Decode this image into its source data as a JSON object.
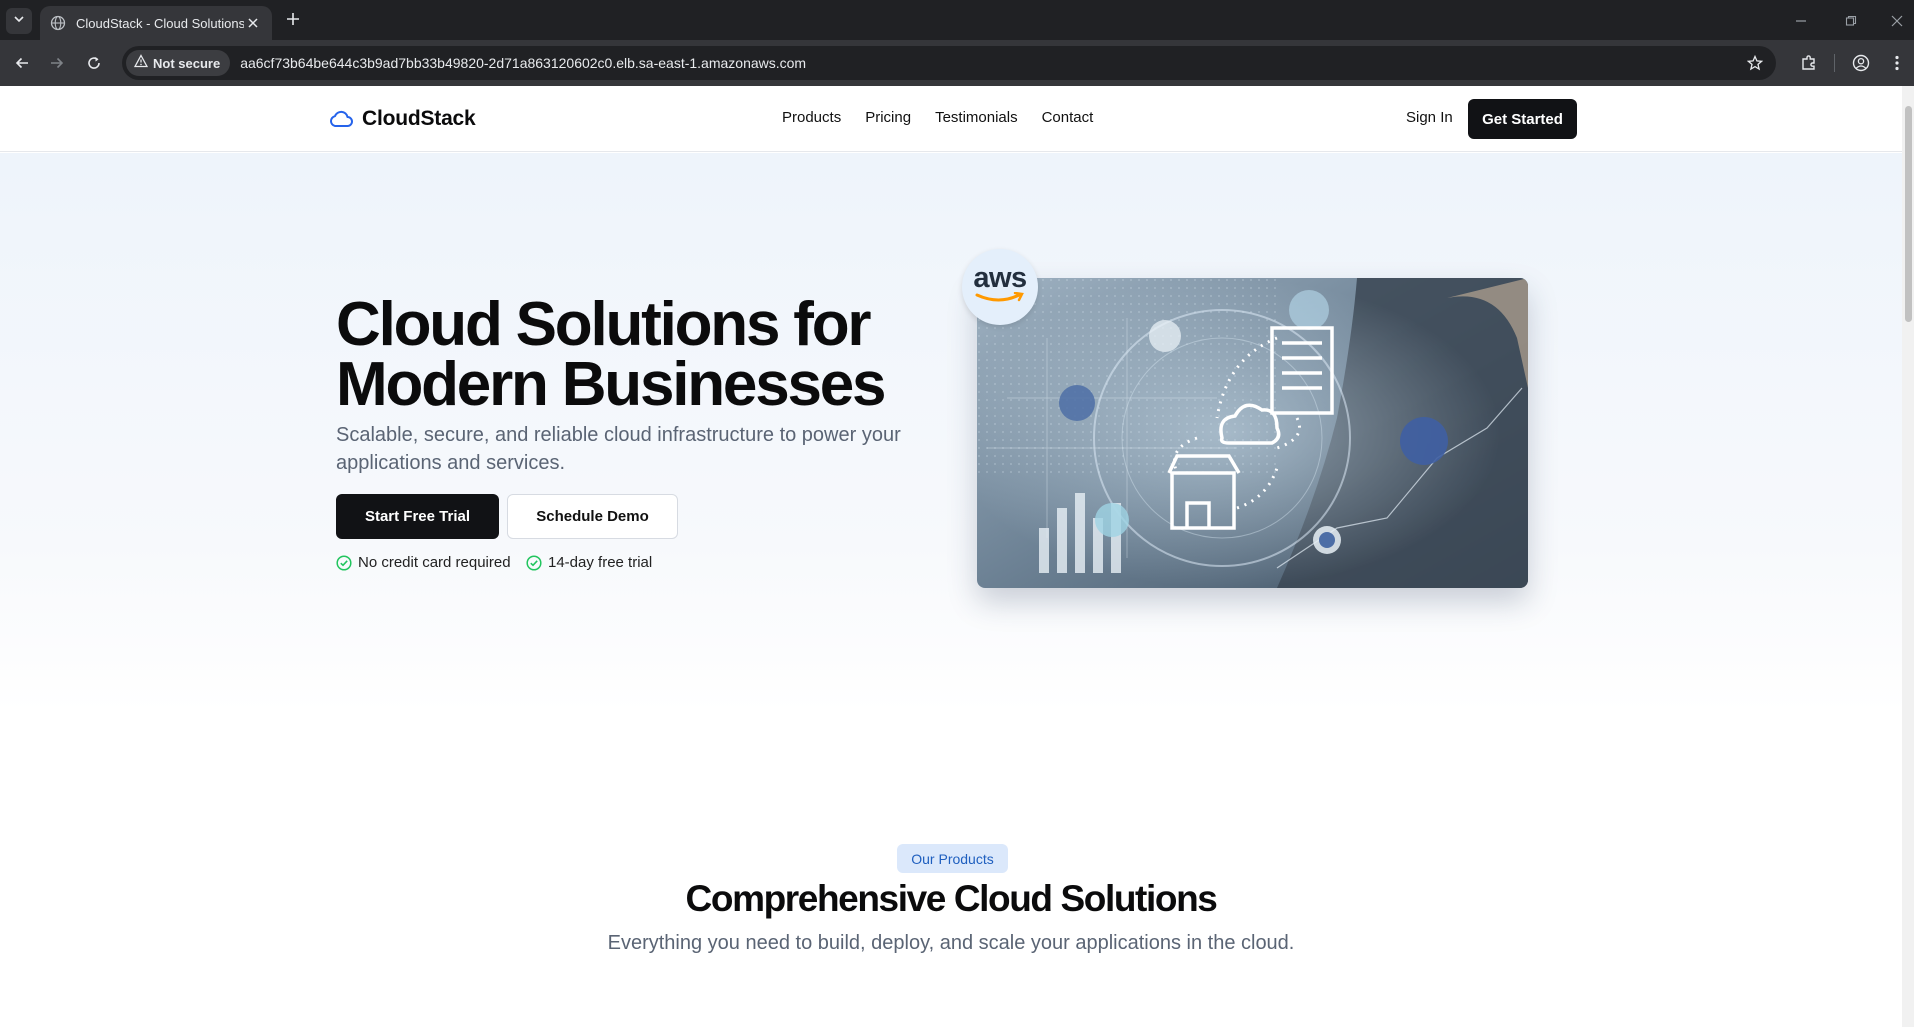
{
  "browser": {
    "tab_title": "CloudStack - Cloud Solutions fo",
    "security_label": "Not secure",
    "url": "aa6cf73b64be644c3b9ad7bb33b49820-2d71a863120602c0.elb.sa-east-1.amazonaws.com",
    "icons": [
      "tab-list-icon",
      "globe-icon",
      "close-icon",
      "plus-icon",
      "minimize-icon",
      "restore-icon",
      "close-window-icon",
      "back-icon",
      "forward-icon",
      "reload-icon",
      "warning-icon",
      "star-icon",
      "extensions-icon",
      "profile-icon",
      "more-icon"
    ]
  },
  "site": {
    "brand": "CloudStack",
    "nav": [
      "Products",
      "Pricing",
      "Testimonials",
      "Contact"
    ],
    "sign_in": "Sign In",
    "get_started": "Get Started"
  },
  "hero": {
    "title": "Cloud Solutions for Modern Businesses",
    "subtitle": "Scalable, secure, and reliable cloud infrastructure to power your applications and services.",
    "primary_cta": "Start Free Trial",
    "secondary_cta": "Schedule Demo",
    "perks": [
      "No credit card required",
      "14-day free trial"
    ],
    "badge_text": "aws",
    "accent_color": "#22c55e"
  },
  "products": {
    "badge": "Our Products",
    "title": "Comprehensive Cloud Solutions",
    "subtitle": "Everything you need to build, deploy, and scale your applications in the cloud."
  },
  "colors": {
    "brand_blue": "#2563eb",
    "dark_button": "#111215",
    "chrome_dark": "#202124"
  }
}
